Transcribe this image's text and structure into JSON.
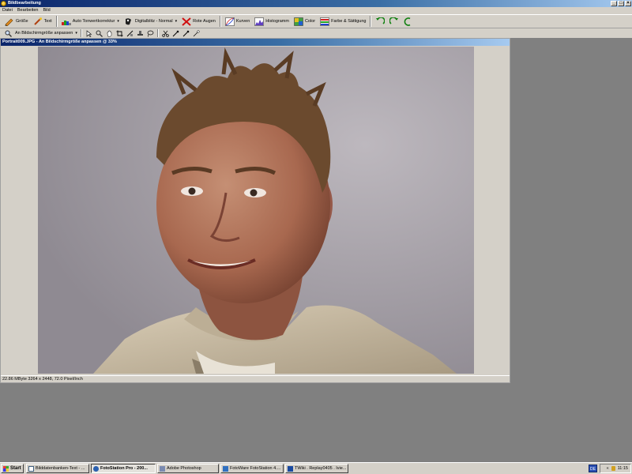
{
  "window": {
    "title": "Bildbearbeitung",
    "controls": [
      "_",
      "□",
      "×"
    ]
  },
  "menu": [
    "Datei",
    "Bearbeiten",
    "Bild"
  ],
  "toolbar": {
    "size_label": "Größe",
    "text_label": "Text",
    "auto_tone_label": "Auto Tonwertkorrektur",
    "flash_label": "Digitalblitz - Normal",
    "red_eye_label": "Rote Augen",
    "curves_label": "Kurven",
    "histogram_label": "Histogramm",
    "color_label": "Color",
    "color_sat_label": "Farbe & Sättigung"
  },
  "toolbar2": {
    "zoom_label": "An Bildschirmgröße anpassen"
  },
  "document": {
    "title": "Portrait009.JPG - An Bildschirmgröße anpassen @ 33%",
    "status": "22.86 MByte  3264 x 2448, 72.0 Pixel/Inch"
  },
  "taskbar": {
    "start_label": "Start",
    "items": [
      {
        "label": "Bilddatenbanken-Text - ..."
      },
      {
        "label": "FotoStation Pro - 200..."
      },
      {
        "label": "Adobe Photoshop"
      },
      {
        "label": "FotoWare FotoStation 4...."
      },
      {
        "label": "TWiki . Replay0405 . Ivie..."
      }
    ],
    "lang": "DE",
    "clock": "11:15"
  },
  "colors": {
    "titlebar": "#0a246a",
    "chrome": "#d4d0c8",
    "desktop": "#808080"
  }
}
